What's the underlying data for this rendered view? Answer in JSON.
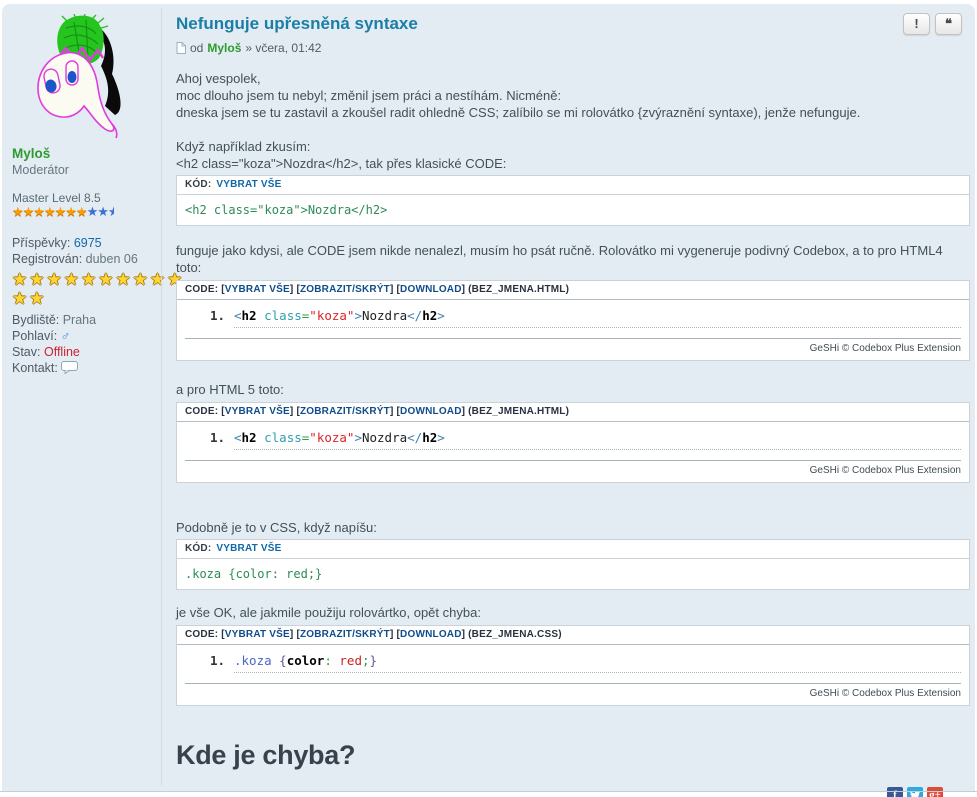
{
  "actions": {
    "report_label": "!",
    "quote_label": "❝"
  },
  "sidebar": {
    "username": "Myloš",
    "rank": "Moderátor",
    "level_label": "Master Level 8.5",
    "level_stars": {
      "gold": 7,
      "blue": 2,
      "half": true
    },
    "rating_rows": [
      10,
      2
    ],
    "fields1": [
      {
        "label": "Příspěvky:",
        "value": "6975",
        "style": "link"
      },
      {
        "label": "Registrován:",
        "value": "duben 06",
        "style": ""
      }
    ],
    "fields2": [
      {
        "label": "Bydliště:",
        "value": "Praha",
        "style": ""
      },
      {
        "label": "Pohlaví:",
        "value": "",
        "style": "",
        "icon": "male-icon"
      },
      {
        "label": "Stav:",
        "value": "Offline",
        "style": "offline"
      },
      {
        "label": "Kontakt:",
        "value": "",
        "style": "",
        "icon": "pm-icon"
      }
    ]
  },
  "post": {
    "title": "Nefunguje upřesněná syntaxe",
    "byline": {
      "prefix": "od",
      "author": "Myloš",
      "suffix": "» včera, 01:42"
    },
    "p1": [
      "Ahoj vespolek,",
      "moc dlouho jsem tu nebyl; změnil jsem práci a nestíhám. Nicméně:",
      "dneska jsem se tu zastavil a zkoušel radit ohledně CSS; zalíbilo se mi rolovátko {zvýraznění syntaxe), jenže nefunguje."
    ],
    "p2": [
      "Když například zkusím:",
      "<h2 class=\"koza\">Nozdra</h2>, tak přes klasické CODE:"
    ],
    "p3": [
      "funguje jako kdysi, ale CODE jsem nikde nenalezl, musím ho psát ručně. Rolovátko mi vygeneruje podivný Codebox, a to pro HTML4",
      "toto:"
    ],
    "p4": "a pro HTML 5 toto:",
    "p5": "Podobně je to v CSS, když napíšu:",
    "p6": "je vše OK, ale jakmile použiju rolovártko, opět chyba:",
    "question": "Kde je chyba?"
  },
  "kod": {
    "label": "KÓD:",
    "select_all": "VYBRAT VŠE",
    "box1_code": "<h2 class=\"koza\">Nozdra</h2>",
    "box2_code": ".koza {color: red;}"
  },
  "geshi": {
    "label": "CODE:",
    "links": [
      "VYBRAT VŠE",
      "ZOBRAZIT/SKRÝT",
      "DOWNLOAD"
    ],
    "footer": "GeSHi © Codebox Plus Extension",
    "token_sets": {
      "html": [
        {
          "text": "<",
          "color": "#3c7fae"
        },
        {
          "text": "h2",
          "color": "#000000",
          "bold": true
        },
        {
          "text": " "
        },
        {
          "text": "class",
          "color": "#2d9fb0"
        },
        {
          "text": "=",
          "color": "#2f9e3f"
        },
        {
          "text": "\"koza\"",
          "color": "#d92626"
        },
        {
          "text": ">",
          "color": "#3c7fae"
        },
        {
          "text": "Nozdra",
          "color": "#222222"
        },
        {
          "text": "</",
          "color": "#3c7fae"
        },
        {
          "text": "h2",
          "color": "#000000",
          "bold": true
        },
        {
          "text": ">",
          "color": "#3c7fae"
        }
      ],
      "css": [
        {
          "text": ".koza",
          "color": "#4a67c7"
        },
        {
          "text": " "
        },
        {
          "text": "{",
          "color": "#66539c"
        },
        {
          "text": "color",
          "color": "#000000",
          "bold": true
        },
        {
          "text": ":",
          "color": "#2f9e3f"
        },
        {
          "text": " red",
          "color": "#cc2222"
        },
        {
          "text": ";",
          "color": "#2f9e3f"
        },
        {
          "text": "}",
          "color": "#66539c"
        }
      ]
    },
    "boxes": {
      "html1": {
        "filename": "(BEZ_JMENA.HTML)",
        "line_number": "1.",
        "tokens": "html"
      },
      "html2": {
        "filename": "(BEZ_JMENA.HTML)",
        "line_number": "1.",
        "tokens": "html"
      },
      "css": {
        "filename": "(BEZ_JMENA.CSS)",
        "line_number": "1.",
        "tokens": "css"
      }
    }
  },
  "social": [
    {
      "name": "facebook",
      "bg": "#3a579a",
      "glyph": "f"
    },
    {
      "name": "twitter",
      "bg": "#2caae1",
      "glyph": ""
    },
    {
      "name": "googleplus",
      "bg": "#dd4b39",
      "glyph": "g+"
    }
  ]
}
